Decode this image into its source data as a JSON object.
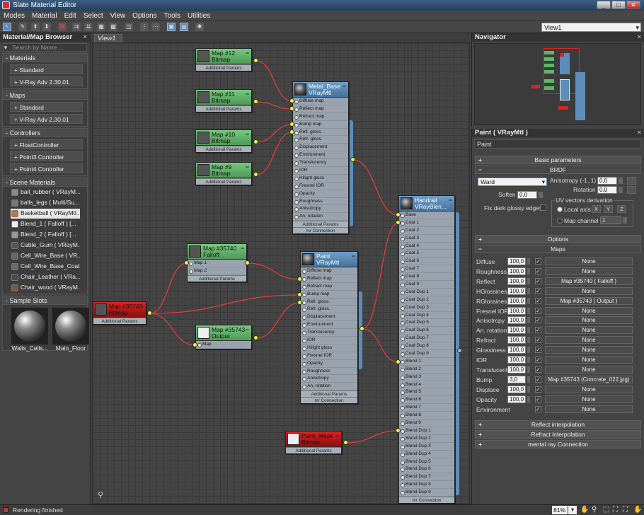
{
  "window": {
    "title": "Slate Material Editor",
    "min": "_",
    "max": "□",
    "close": "✕"
  },
  "menu": [
    "Modes",
    "Material",
    "Edit",
    "Select",
    "View",
    "Options",
    "Tools",
    "Utilities"
  ],
  "view_selector": "View1",
  "browser": {
    "title": "Material/Map Browser",
    "search_placeholder": "Search by Name ...",
    "groups": [
      {
        "header": "- Materials",
        "items": [
          "+ Standard",
          "+ V-Ray Adv 2.30.01"
        ]
      },
      {
        "header": "- Maps",
        "items": [
          "+ Standard",
          "+ V-Ray Adv 2.30.01"
        ]
      },
      {
        "header": "- Controllers",
        "items": [
          "+ FloatController",
          "+ Point3 Controller",
          "+ Point4 Controller"
        ]
      }
    ],
    "scene_header": "- Scene Materials",
    "scene_materials": [
      {
        "label": "ball_rubber ( VRayM...",
        "swatch": "#8a8a8a"
      },
      {
        "label": "balls_legs ( Multi/Su...",
        "swatch": "#777777"
      },
      {
        "label": "Basketball ( VRayMtl...",
        "swatch": "#d07030"
      },
      {
        "label": "Blend_1 ( Falloff ) [...",
        "swatch": "#eeeeee"
      },
      {
        "label": "Blend_2 ( Falloff ) [...",
        "swatch": "#999999"
      },
      {
        "label": "Cable_Gum ( VRayM...",
        "swatch": "#555555"
      },
      {
        "label": "Cell_Wire_Base ( VR...",
        "swatch": "#666666"
      },
      {
        "label": "Cell_Wire_Base_Coat...",
        "swatch": "#6a6a6a"
      },
      {
        "label": "Chair_Leather ( VRa...",
        "swatch": "#4a4a4a"
      },
      {
        "label": "Chair_wood ( VRayM...",
        "swatch": "#7a5a3a"
      }
    ],
    "slots_header": "- Sample Slots",
    "slots": [
      "Walls_Cells...",
      "Main_Floor"
    ]
  },
  "view_tab": "View1",
  "nodes": {
    "map12": {
      "title": "Map #12\nBitmap",
      "footer": "Additional Params"
    },
    "map11": {
      "title": "Map #11\nBitmap",
      "footer": "Additional Params"
    },
    "map10": {
      "title": "Map #10\nBitmap",
      "footer": "Additional Params"
    },
    "map9": {
      "title": "Map #9\nBitmap",
      "footer": "Additional Params"
    },
    "metal": {
      "title": "Metal_Base\nVRayMtl",
      "footer1": "Additional Params",
      "footer2": "mr Connection"
    },
    "falloff": {
      "title": "Map #35740\nFalloff",
      "slots": [
        "Map 1",
        "Map 2"
      ],
      "footer": "Additional Params"
    },
    "bitmap43": {
      "title": "Map #35743\nBitmap",
      "footer": "Additional Params"
    },
    "output": {
      "title": "Map #35743\nOutput",
      "slots": [
        "Map"
      ]
    },
    "paint": {
      "title": "Paint\nVRayMtl",
      "footer1": "Additional Params",
      "footer2": "mr Connection"
    },
    "paintmask": {
      "title": "Paint_Mask\nBitmap",
      "footer": "Additional Params"
    },
    "handrail": {
      "title": "Handrail\nVRayBlen...",
      "footer": "mr Connection"
    }
  },
  "vray_slots": [
    "Diffuse map",
    "Reflect map",
    "Refract map",
    "Bump map",
    "Refl. gloss.",
    "Refr. gloss.",
    "Displacement",
    "Environment",
    "Translucency",
    "IOR",
    "Hilight gloss",
    "Fresnel IOR",
    "Opacity",
    "Roughness",
    "Anisotropy",
    "An. rotation"
  ],
  "blend_slots": [
    "Base",
    "Coat 1",
    "Coat 2",
    "Coat 3",
    "Coat 4",
    "Coat 5",
    "Coat 6",
    "Coat 7",
    "Coat 8",
    "Coat 9",
    "Coat Dup 1",
    "Coat Dup 2",
    "Coat Dup 3",
    "Coat Dup 4",
    "Coat Dup 5",
    "Coat Dup 6",
    "Coat Dup 7",
    "Coat Dup 8",
    "Coat Dup 9",
    "Blend 1",
    "Blend 2",
    "Blend 3",
    "Blend 4",
    "Blend 5",
    "Blend 6",
    "Blend 7",
    "Blend 8",
    "Blend 9",
    "Blend Dup 1",
    "Blend Dup 2",
    "Blend Dup 3",
    "Blend Dup 4",
    "Blend Dup 5",
    "Blend Dup 6",
    "Blend Dup 7",
    "Blend Dup 8",
    "Blend Dup 9"
  ],
  "navigator": {
    "title": "Navigator"
  },
  "props": {
    "title": "Paint  ( VRayMtl )",
    "name": "Paint",
    "basic": "Basic parameters",
    "brdf": "BRDF",
    "brdf_type": "Ward",
    "anisotropy_label": "Anisotropy (-1..1)",
    "anisotropy": "0,0",
    "rotation_label": "Rotation",
    "rotation": "0,0",
    "soften_label": "Soften",
    "soften": "0,0",
    "fix_label": "Fix dark glossy edges",
    "uv_label": "UV vectors derivation",
    "local_axis": "Local axis",
    "axes": [
      "X",
      "Y",
      "Z"
    ],
    "map_channel_label": "Map channel",
    "map_channel": "1",
    "options": "Options",
    "maps": "Maps",
    "map_rows": [
      {
        "name": "Diffuse",
        "amount": "100,0",
        "check": "✓",
        "map": "None"
      },
      {
        "name": "Roughness",
        "amount": "100,0",
        "check": "✓",
        "map": "None"
      },
      {
        "name": "Reflect",
        "amount": "100,0",
        "check": "✓",
        "map": "Map #35740  ( Falloff )"
      },
      {
        "name": "HGlossiness",
        "amount": "100,0",
        "check": "✓",
        "map": "None"
      },
      {
        "name": "RGlossiness",
        "amount": "100,0",
        "check": "✓",
        "map": "Map #35743  ( Output )"
      },
      {
        "name": "Fresnel IOR",
        "amount": "100,0",
        "check": "✓",
        "map": "None"
      },
      {
        "name": "Anisotropy",
        "amount": "100,0",
        "check": "✓",
        "map": "None"
      },
      {
        "name": "An. rotation",
        "amount": "100,0",
        "check": "✓",
        "map": "None"
      },
      {
        "name": "Refract",
        "amount": "100,0",
        "check": "✓",
        "map": "None"
      },
      {
        "name": "Glossiness",
        "amount": "100,0",
        "check": "✓",
        "map": "None"
      },
      {
        "name": "IOR",
        "amount": "100,0",
        "check": "✓",
        "map": "None"
      },
      {
        "name": "Translucent",
        "amount": "100,0",
        "check": "✓",
        "map": "None"
      },
      {
        "name": "Bump",
        "amount": "3,0",
        "check": "✓",
        "map": "Map #35743 (Concrete_022.jpg)"
      },
      {
        "name": "Displace",
        "amount": "100,0",
        "check": "✓",
        "map": "None"
      },
      {
        "name": "Opacity",
        "amount": "100,0",
        "check": "✓",
        "map": "None"
      },
      {
        "name": "Environment",
        "amount": "",
        "check": "✓",
        "map": "None"
      }
    ],
    "reflect_interp": "Reflect interpolation",
    "refract_interp": "Refract interpolation",
    "mr_conn": "mental ray Connection"
  },
  "status": {
    "text": "Rendering finished",
    "zoom": "81%"
  }
}
